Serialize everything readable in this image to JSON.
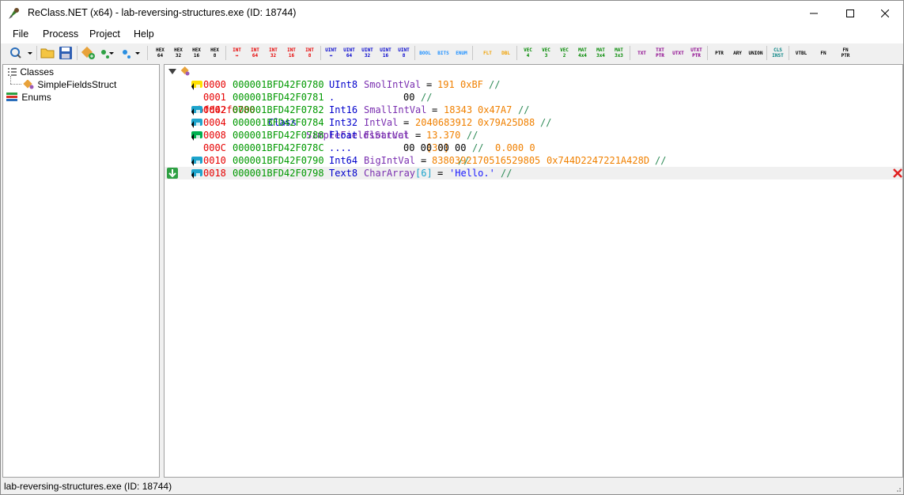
{
  "window": {
    "title": "ReClass.NET (x64) - lab-reversing-structures.exe (ID: 18744)"
  },
  "menu": [
    "File",
    "Process",
    "Project",
    "Help"
  ],
  "toolbar": {
    "hex": [
      [
        "HEX",
        "64"
      ],
      [
        "HEX",
        "32"
      ],
      [
        "HEX",
        "16"
      ],
      [
        "HEX",
        "8"
      ]
    ],
    "int": [
      [
        "INT",
        "↔"
      ],
      [
        "INT",
        "64"
      ],
      [
        "INT",
        "32"
      ],
      [
        "INT",
        "16"
      ],
      [
        "INT",
        "8"
      ]
    ],
    "uint": [
      [
        "UINT",
        "↔"
      ],
      [
        "UINT",
        "64"
      ],
      [
        "UINT",
        "32"
      ],
      [
        "UINT",
        "16"
      ],
      [
        "UINT",
        "8"
      ]
    ],
    "misc": [
      [
        "BOOL",
        ""
      ],
      [
        "BITS",
        ""
      ],
      [
        "ENUM",
        ""
      ]
    ],
    "float": [
      [
        "FLT",
        ""
      ],
      [
        "DBL",
        ""
      ]
    ],
    "vec": [
      [
        "VEC",
        "4"
      ],
      [
        "VEC",
        "3"
      ],
      [
        "VEC",
        "2"
      ],
      [
        "MAT",
        "4x4"
      ],
      [
        "MAT",
        "3x4"
      ],
      [
        "MAT",
        "3x3"
      ]
    ],
    "text": [
      [
        "TXT",
        ""
      ],
      [
        "TXT",
        "PTR"
      ],
      [
        "UTXT",
        ""
      ],
      [
        "UTXT",
        "PTR"
      ]
    ],
    "ptr": [
      [
        "PTR",
        ""
      ],
      [
        "ARY",
        ""
      ],
      [
        "UNION",
        ""
      ]
    ],
    "cls": [
      [
        "CLS",
        "INST"
      ]
    ],
    "fn": [
      [
        "VTBL",
        ""
      ],
      [
        "FN",
        ""
      ],
      [
        "FN",
        "PTR"
      ]
    ],
    "colors": {
      "hex": "#000000",
      "int": "#e60000",
      "uint": "#0000cc",
      "misc": "#1e90ff",
      "float": "#f0a000",
      "vec": "#008800",
      "text": "#8b008b",
      "ptr": "#000000",
      "cls": "#008080",
      "fn": "#000000"
    }
  },
  "tree": {
    "classes_label": "Classes",
    "class_item": "SimpleFieldsStruct",
    "enums_label": "Enums"
  },
  "view": {
    "header": {
      "address": "1bfd42f0780",
      "keyword": "Class",
      "name": "SimpleFieldsStruct",
      "size": "[30]",
      "comment": "//"
    },
    "rows": [
      {
        "tag": "U",
        "tag_color": "#ffe000",
        "offset": "0000",
        "address": "000001BFD42F0780",
        "type": "UInt8",
        "name": "SmolIntVal",
        "eq": "=",
        "value": "191",
        "hex": "0xBF",
        "comment": "//"
      },
      {
        "tag": "",
        "tag_color": "",
        "offset": "0001",
        "address": "000001BFD42F0781",
        "type": ".",
        "name": "",
        "eq": "",
        "value": "",
        "hex": "",
        "bytes": "00",
        "comment": "//"
      },
      {
        "tag": "I",
        "tag_color": "#1ea4cc",
        "offset": "0002",
        "address": "000001BFD42F0782",
        "type": "Int16",
        "name": "SmallIntVal",
        "eq": "=",
        "value": "18343",
        "hex": "0x47A7",
        "comment": "//"
      },
      {
        "tag": "I",
        "tag_color": "#1ea4cc",
        "offset": "0004",
        "address": "000001BFD42F0784",
        "type": "Int32",
        "name": "IntVal",
        "eq": "=",
        "value": "2040683912",
        "hex": "0x79A25D88",
        "comment": "//"
      },
      {
        "tag": "F",
        "tag_color": "#00b050",
        "offset": "0008",
        "address": "000001BFD42F0788",
        "type": "Float",
        "name": "FloatVal",
        "eq": "=",
        "value": "13.370",
        "hex": "",
        "comment": "//"
      },
      {
        "tag": "",
        "tag_color": "",
        "offset": "000C",
        "address": "000001BFD42F078C",
        "type": "....",
        "name": "",
        "eq": "",
        "value": "",
        "hex": "",
        "bytes": "00 00 00 00",
        "comment": "//",
        "tail": "0.000 0"
      },
      {
        "tag": "I",
        "tag_color": "#1ea4cc",
        "offset": "0010",
        "address": "000001BFD42F0790",
        "type": "Int64",
        "name": "BigIntVal",
        "eq": "=",
        "value": "8380392170516529805",
        "hex": "0x744D2247221A428D",
        "comment": "//"
      },
      {
        "tag": "T",
        "tag_color": "#1ea4cc",
        "offset": "0018",
        "address": "000001BFD42F0798",
        "type": "Text8",
        "name": "CharArray",
        "index": "[6]",
        "eq": "=",
        "value": "'Hello.'",
        "hex": "",
        "comment": "//",
        "selected": true
      }
    ]
  },
  "status": "lab-reversing-structures.exe (ID: 18744)"
}
